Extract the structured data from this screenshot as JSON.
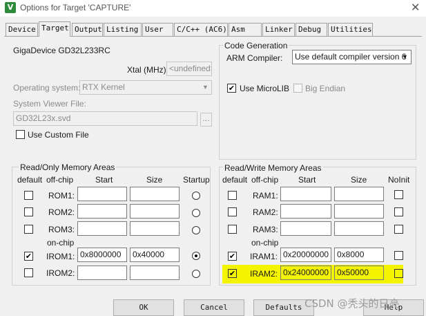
{
  "window": {
    "title": "Options for Target 'CAPTURE'",
    "icon_letter": "V",
    "close_glyph": "✕"
  },
  "tabs": [
    {
      "label": "Device",
      "active": false
    },
    {
      "label": "Target",
      "active": true
    },
    {
      "label": "Output",
      "active": false
    },
    {
      "label": "Listing",
      "active": false
    },
    {
      "label": "User",
      "active": false
    },
    {
      "label": "C/C++ (AC6)",
      "active": false
    },
    {
      "label": "Asm",
      "active": false
    },
    {
      "label": "Linker",
      "active": false
    },
    {
      "label": "Debug",
      "active": false
    },
    {
      "label": "Utilities",
      "active": false
    }
  ],
  "target": {
    "device_name": "GigaDevice GD32L233RC",
    "xtal_label": "Xtal (MHz):",
    "xtal_value": "<undefined>",
    "os_label": "Operating system:",
    "os_value": "RTX Kernel",
    "svd_label": "System Viewer File:",
    "svd_value": "GD32L23x.svd",
    "browse_label": "...",
    "custom_file_label": "Use Custom File",
    "custom_file_checked": false
  },
  "code_generation": {
    "legend": "Code Generation",
    "compiler_label": "ARM Compiler:",
    "compiler_value": "Use default compiler version 6",
    "microlib_label": "Use MicroLIB",
    "microlib_checked": true,
    "big_endian_label": "Big Endian",
    "big_endian_checked": false
  },
  "readonly_memory": {
    "legend": "Read/Only Memory Areas",
    "headers": {
      "default": "default",
      "offchip": "off-chip",
      "start": "Start",
      "size": "Size",
      "startup": "Startup"
    },
    "onchip_label": "on-chip",
    "rows": [
      {
        "name": "ROM1:",
        "default": false,
        "start": "",
        "size": "",
        "startup": false
      },
      {
        "name": "ROM2:",
        "default": false,
        "start": "",
        "size": "",
        "startup": false
      },
      {
        "name": "ROM3:",
        "default": false,
        "start": "",
        "size": "",
        "startup": false
      },
      {
        "name": "IROM1:",
        "default": true,
        "start": "0x8000000",
        "size": "0x40000",
        "startup": true
      },
      {
        "name": "IROM2:",
        "default": false,
        "start": "",
        "size": "",
        "startup": false
      }
    ]
  },
  "readwrite_memory": {
    "legend": "Read/Write Memory Areas",
    "headers": {
      "default": "default",
      "offchip": "off-chip",
      "start": "Start",
      "size": "Size",
      "noinit": "NoInit"
    },
    "onchip_label": "on-chip",
    "rows": [
      {
        "name": "RAM1:",
        "default": false,
        "start": "",
        "size": "",
        "noinit": false
      },
      {
        "name": "RAM2:",
        "default": false,
        "start": "",
        "size": "",
        "noinit": false
      },
      {
        "name": "RAM3:",
        "default": false,
        "start": "",
        "size": "",
        "noinit": false
      },
      {
        "name": "IRAM1:",
        "default": true,
        "start": "0x20000000",
        "size": "0x8000",
        "noinit": false
      },
      {
        "name": "IRAM2:",
        "default": true,
        "start": "0x24000000",
        "size": "0x50000",
        "noinit": false
      }
    ]
  },
  "buttons": {
    "ok": "OK",
    "cancel": "Cancel",
    "defaults": "Defaults",
    "help": "Help"
  },
  "watermark": "CSDN @秃头的日亮",
  "colors": {
    "highlight": "#f4f400",
    "background": "#f0f0f0"
  }
}
